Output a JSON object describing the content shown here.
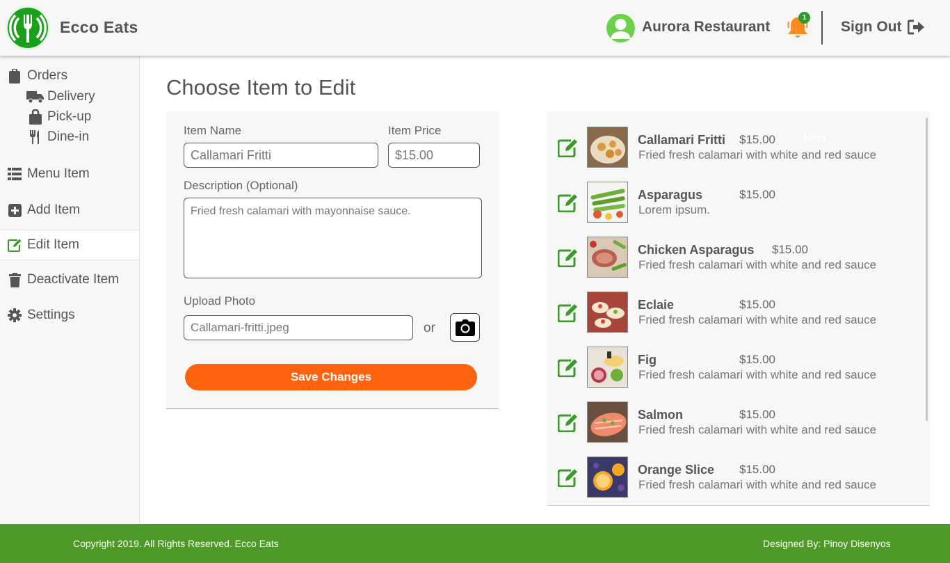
{
  "header": {
    "brand": "Ecco Eats",
    "restaurant_name": "Aurora Restaurant",
    "notification_count": "1",
    "sign_out_label": "Sign Out",
    "colors": {
      "brand_green": "#1aa01a",
      "bell_orange": "#ff8a1e",
      "header_bg": "#f7f7f7"
    }
  },
  "sidebar": {
    "items": [
      {
        "label": "Orders",
        "icon": "clipboard-icon"
      },
      {
        "label": "Delivery",
        "icon": "truck-icon"
      },
      {
        "label": "Pick-up",
        "icon": "shopping-bag-icon"
      },
      {
        "label": "Dine-in",
        "icon": "utensils-icon"
      },
      {
        "label": "Menu Item",
        "icon": "list-icon"
      },
      {
        "label": "Add Item",
        "icon": "plus-square-icon"
      },
      {
        "label": "Edit Item",
        "icon": "edit-icon"
      },
      {
        "label": "Deactivate Item",
        "icon": "trash-icon"
      },
      {
        "label": "Settings",
        "icon": "gear-icon"
      }
    ],
    "active": "Edit Item"
  },
  "main": {
    "title": "Choose Item to Edit",
    "form": {
      "item_name_label": "Item Name",
      "item_name_value": "Callamari Fritti",
      "item_price_label": "Item Price",
      "item_price_value": "$15.00",
      "description_label": "Description (Optional)",
      "description_value": "Fried fresh calamari with mayonnaise sauce.",
      "upload_label": "Upload Photo",
      "upload_value": "Callamari-fritti.jpeg",
      "or_text": "or",
      "save_label": "Save Changes",
      "save_color": "#ff620d"
    },
    "items": [
      {
        "name": "Callamari Fritti",
        "price": "$15.00",
        "description": "Fried fresh calamari with white and red sauce",
        "badge": "New"
      },
      {
        "name": "Asparagus",
        "price": "$15.00",
        "description": "Lorem ipsum."
      },
      {
        "name": "Chicken Asparagus",
        "price": "$15.00",
        "description": "Fried fresh calamari with white and red sauce"
      },
      {
        "name": "Eclaie",
        "price": "$15.00",
        "description": "Fried fresh calamari with white and red sauce"
      },
      {
        "name": "Fig",
        "price": "$15.00",
        "description": "Fried fresh calamari with white and red sauce"
      },
      {
        "name": "Salmon",
        "price": "$15.00",
        "description": "Fried fresh calamari with white and red sauce"
      },
      {
        "name": "Orange Slice",
        "price": "$15.00",
        "description": "Fried fresh calamari with white and red sauce"
      }
    ]
  },
  "footer": {
    "copyright": "Copyright 2019. All Rights Reserved. Ecco Eats",
    "designed_by": "Designed By: Pinoy Disenyos",
    "color": "#4d9a28"
  }
}
